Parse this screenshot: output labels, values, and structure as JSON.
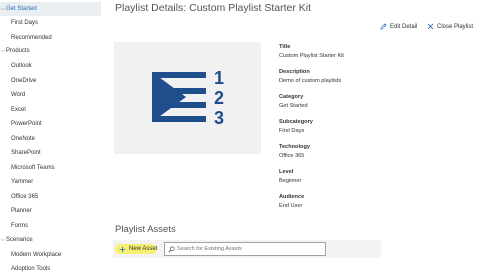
{
  "sidebar": {
    "items": [
      {
        "label": "Get Started",
        "level": 1,
        "selected": true,
        "chevron": true
      },
      {
        "label": "First Days",
        "level": 2
      },
      {
        "label": "Recommended",
        "level": 2
      },
      {
        "label": "Products",
        "level": 0,
        "chevron": true
      },
      {
        "label": "Outlook",
        "level": 2
      },
      {
        "label": "OneDrive",
        "level": 2
      },
      {
        "label": "Word",
        "level": 2
      },
      {
        "label": "Excel",
        "level": 2
      },
      {
        "label": "PowerPoint",
        "level": 2
      },
      {
        "label": "OneNote",
        "level": 2
      },
      {
        "label": "SharePoint",
        "level": 2
      },
      {
        "label": "Microsoft Teams",
        "level": 2
      },
      {
        "label": "Yammer",
        "level": 2
      },
      {
        "label": "Office 365",
        "level": 2
      },
      {
        "label": "Planner",
        "level": 2
      },
      {
        "label": "Forms",
        "level": 2
      },
      {
        "label": "Scenarios",
        "level": 0,
        "chevron": true
      },
      {
        "label": "Modern Workplace",
        "level": 2
      },
      {
        "label": "Adoption Tools",
        "level": 2
      }
    ]
  },
  "header": {
    "title": "Playlist Details: Custom Playlist Starter Kit",
    "edit_label": "Edit Detail",
    "close_label": "Close Playlist"
  },
  "details": {
    "fields": [
      {
        "label": "Title",
        "value": "Custom Playlist Starter Kit"
      },
      {
        "label": "Description",
        "value": "Demo of custom playlists"
      },
      {
        "label": "Category",
        "value": "Get Started"
      },
      {
        "label": "Subcategory",
        "value": "First Days"
      },
      {
        "label": "Technology",
        "value": "Office 365"
      },
      {
        "label": "Level",
        "value": "Beginner"
      },
      {
        "label": "Audience",
        "value": "End User"
      }
    ]
  },
  "thumbnail": {
    "digits": [
      "1",
      "2",
      "3"
    ],
    "color": "#1f4e8c"
  },
  "assets": {
    "title": "Playlist Assets",
    "new_asset_label": "New Asset",
    "search_placeholder": "Search for Existing Assets"
  },
  "colors": {
    "accent": "#2b6cb0",
    "highlight": "#f5f06a"
  }
}
